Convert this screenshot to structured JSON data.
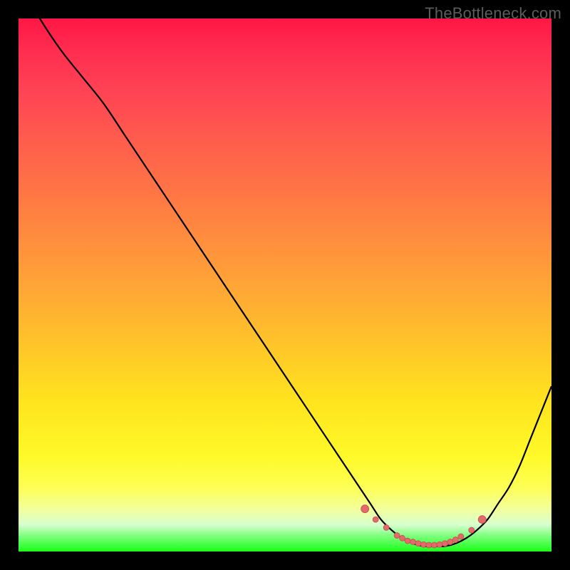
{
  "watermark": "TheBottleneck.com",
  "colors": {
    "curve": "#000000",
    "dots": "#e26a6a",
    "dots_stroke": "#c84f4f",
    "background_black": "#000000"
  },
  "chart_data": {
    "type": "line",
    "title": "",
    "xlabel": "",
    "ylabel": "",
    "xlim": [
      0,
      100
    ],
    "ylim": [
      0,
      100
    ],
    "grid": false,
    "legend": false,
    "series": [
      {
        "name": "bottleneck-curve",
        "x": [
          0,
          4,
          8,
          12,
          16,
          20,
          24,
          28,
          32,
          36,
          40,
          44,
          48,
          52,
          56,
          60,
          64,
          66,
          68,
          70,
          72,
          74,
          76,
          78,
          80,
          82,
          84,
          86,
          88,
          90,
          92,
          94,
          96,
          98,
          100
        ],
        "values": [
          107,
          100,
          94,
          89,
          84,
          78,
          72,
          66,
          60,
          54,
          48,
          42,
          36,
          30,
          24,
          18,
          12,
          9,
          6,
          4,
          2.5,
          1.5,
          1,
          1,
          1,
          1.5,
          2.5,
          4,
          6,
          9,
          12,
          16,
          21,
          26,
          31
        ]
      }
    ],
    "dotted_region": {
      "name": "bottom-dots",
      "x": [
        65,
        67,
        69,
        71,
        72,
        73,
        74,
        75,
        76,
        77,
        78,
        79,
        80,
        81,
        82,
        83,
        85,
        87
      ],
      "values": [
        8,
        6,
        4.5,
        3,
        2.5,
        2,
        1.8,
        1.5,
        1.3,
        1.2,
        1.2,
        1.3,
        1.5,
        1.8,
        2.2,
        2.8,
        4,
        6
      ]
    }
  }
}
